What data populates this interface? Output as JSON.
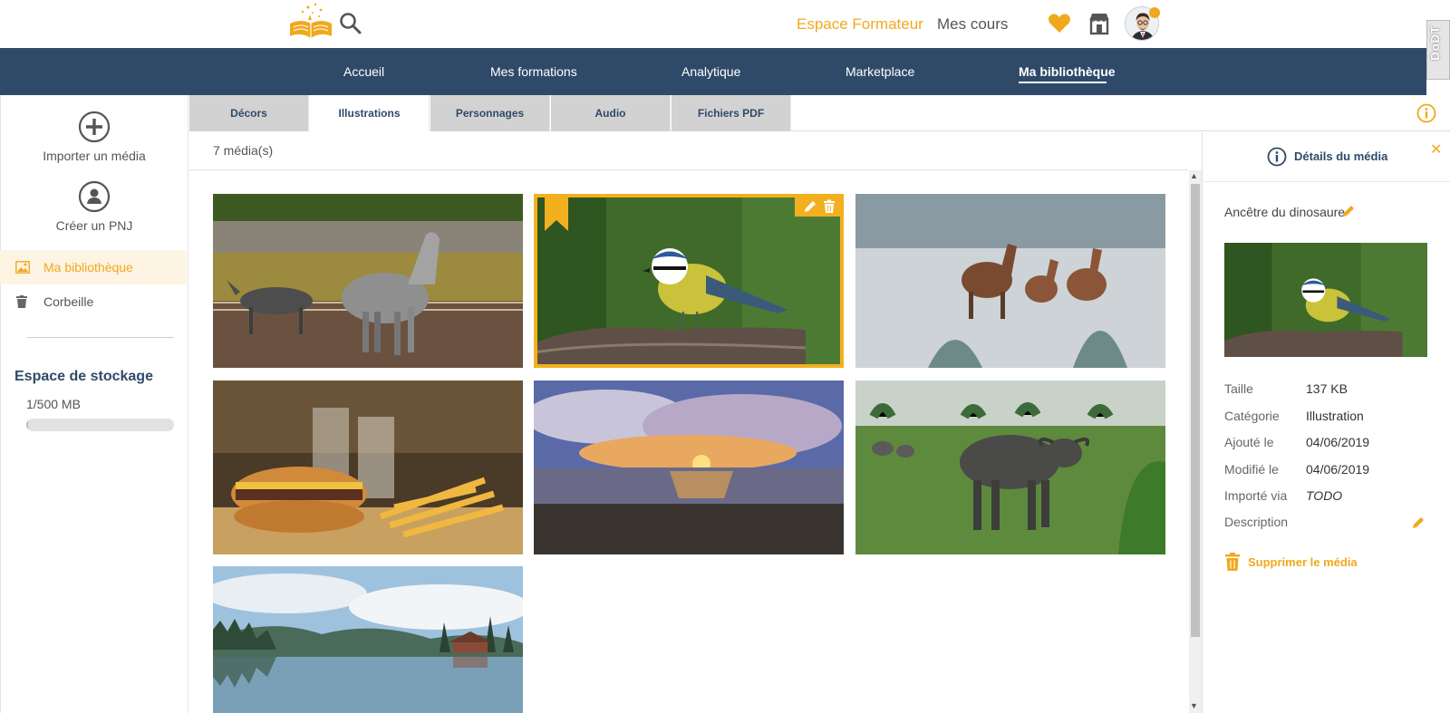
{
  "header": {
    "logo_icon": "book-logo-icon",
    "search_icon": "search-icon",
    "espace_formateur": "Espace Formateur",
    "mes_cours": "Mes cours",
    "favorites_icon": "heart-icon",
    "store_icon": "store-icon",
    "side_tab": "DoDT",
    "accent_color": "#f2a81d"
  },
  "nav": {
    "items": [
      {
        "label": "Accueil"
      },
      {
        "label": "Mes formations"
      },
      {
        "label": "Analytique"
      },
      {
        "label": "Marketplace"
      },
      {
        "label": "Ma bibliothèque"
      }
    ],
    "active": "Ma bibliothèque",
    "background": "#2f4a69"
  },
  "sidebar": {
    "import_label": "Importer un média",
    "create_label": "Créer un PNJ",
    "library_label": "Ma bibliothèque",
    "trash_label": "Corbeille",
    "storage_title": "Espace de stockage",
    "storage_value": "1/500 MB",
    "storage_fraction": 0.002
  },
  "tabs": [
    {
      "label": "Décors"
    },
    {
      "label": "Illustrations"
    },
    {
      "label": "Personnages"
    },
    {
      "label": "Audio"
    },
    {
      "label": "Fichiers PDF"
    }
  ],
  "active_tab": "Illustrations",
  "content": {
    "count": "7 média(s)"
  },
  "details": {
    "title": "Détails du média",
    "name": "Ancêtre du dinosaure",
    "rows": [
      {
        "key": "Taille",
        "value": "137 KB"
      },
      {
        "key": "Catégorie",
        "value": "Illustration"
      },
      {
        "key": "Ajouté le",
        "value": "04/06/2019"
      },
      {
        "key": "Modifié le",
        "value": "04/06/2019"
      },
      {
        "key": "Importé via",
        "value": "TODO"
      },
      {
        "key": "Description",
        "value": ""
      }
    ],
    "delete_label": "Supprimer le média"
  }
}
